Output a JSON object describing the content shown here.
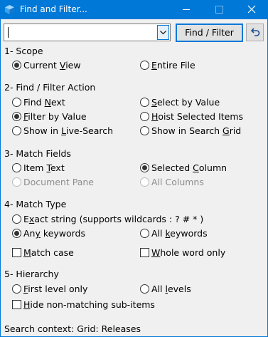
{
  "window": {
    "title": "Find and Filter...",
    "accent_color": "#0078d7",
    "controls": [
      "minimize-icon",
      "maximize-icon",
      "close-icon"
    ]
  },
  "search": {
    "value": "",
    "placeholder": ""
  },
  "buttons": {
    "find_filter": "Find / Filter",
    "undo_icon": "undo-icon"
  },
  "sections": {
    "scope": {
      "header": "1- Scope",
      "current_view": {
        "pre": "Current ",
        "acc": "V",
        "post": "iew"
      },
      "entire_file": {
        "pre": "",
        "acc": "E",
        "post": "ntire File"
      }
    },
    "action": {
      "header": "2- Find / Filter Action",
      "find_next": {
        "pre": "Find ",
        "acc": "N",
        "post": "ext"
      },
      "select_by_value": {
        "pre": "",
        "acc": "S",
        "post": "elect by Value"
      },
      "filter_by_value": {
        "pre": "",
        "acc": "F",
        "post": "ilter by Value"
      },
      "hoist_selected": {
        "pre": "",
        "acc": "H",
        "post": "oist Selected Items"
      },
      "live_search": {
        "pre": "Show in ",
        "acc": "L",
        "post": "ive-Search"
      },
      "search_grid": {
        "pre": "Show in Search ",
        "acc": "G",
        "post": "rid"
      }
    },
    "fields": {
      "header": "3- Match Fields",
      "item_text": {
        "pre": "Item ",
        "acc": "T",
        "post": "ext"
      },
      "selected_column": {
        "pre": "Selected ",
        "acc": "C",
        "post": "olumn"
      },
      "document_pane": "Document Pane",
      "all_columns": "All Columns"
    },
    "type": {
      "header": "4- Match Type",
      "exact": {
        "pre": "E",
        "acc": "x",
        "post": "act string (supports wildcards : ? # * )"
      },
      "any_keywords": {
        "pre": "An",
        "acc": "y",
        "post": " keywords"
      },
      "all_keywords": {
        "pre": "All ",
        "acc": "k",
        "post": "eywords"
      },
      "match_case": {
        "pre": "",
        "acc": "M",
        "post": "atch case"
      },
      "whole_word": {
        "pre": "",
        "acc": "W",
        "post": "hole word only"
      }
    },
    "hierarchy": {
      "header": "5- Hierarchy",
      "first_level": {
        "pre": "",
        "acc": "F",
        "post": "irst level only"
      },
      "all_levels": {
        "pre": "All ",
        "acc": "l",
        "post": "evels"
      },
      "hide_non_matching": {
        "pre": "",
        "acc": "H",
        "post": "ide non-matching sub-items"
      }
    }
  },
  "status": "Search context: Grid: Releases"
}
